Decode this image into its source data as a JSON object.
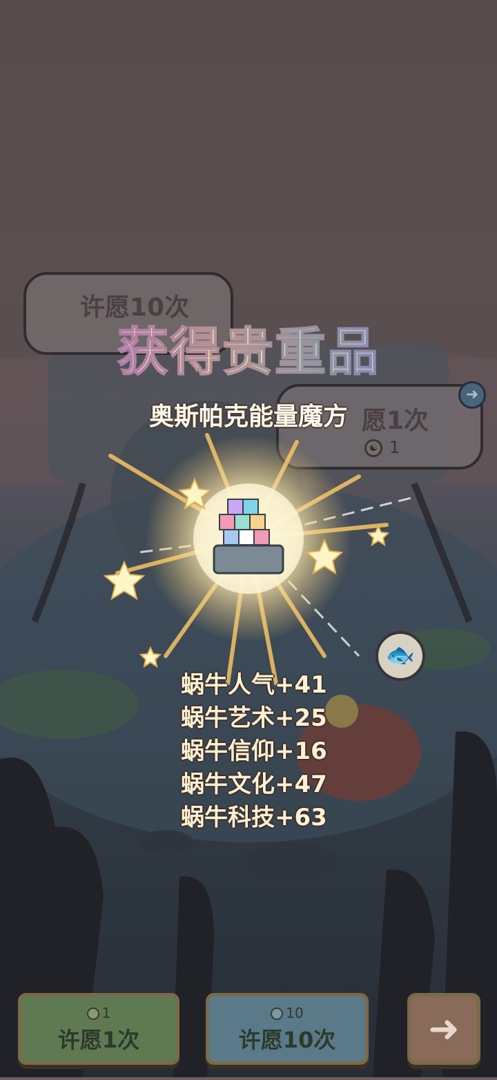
{
  "popup": {
    "headline": "获得贵重品",
    "item_name": "奥斯帕克能量魔方",
    "stats": [
      "蜗牛人气+41",
      "蜗牛艺术+25",
      "蜗牛信仰+16",
      "蜗牛文化+47",
      "蜗牛科技+63"
    ]
  },
  "background": {
    "wish_bubble_left_title": "许愿10次",
    "wish_bubble_right_title": "愿1次",
    "wish_bubble_right_cost": "1"
  },
  "buttons": {
    "wish_once": {
      "cost": "1",
      "label": "许愿1次"
    },
    "wish_ten": {
      "cost": "10",
      "label": "许愿10次"
    }
  },
  "colors": {
    "wish_once_bg": "#5f7a52",
    "wish_ten_bg": "#5a7a8a",
    "next_bg": "#8a6a58"
  },
  "icons": {
    "next": "arrow-right-icon",
    "coin": "coin-icon",
    "fish": "fish-icon",
    "share": "arrow-right-icon"
  }
}
